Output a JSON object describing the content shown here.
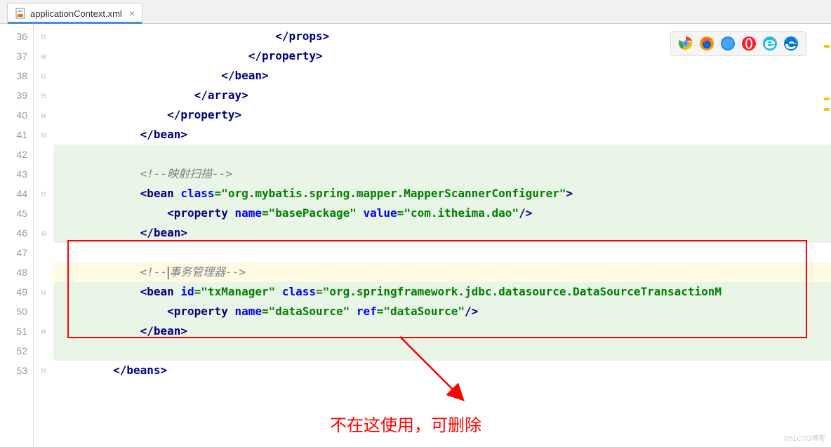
{
  "tab": {
    "filename": "applicationContext.xml",
    "close": "×"
  },
  "lines": {
    "start": 36,
    "end": 53
  },
  "code": {
    "l36": {
      "indent": "                                ",
      "tag": "</props>"
    },
    "l37": {
      "indent": "                            ",
      "tag": "</property>"
    },
    "l38": {
      "indent": "                        ",
      "tag": "</bean>"
    },
    "l39": {
      "indent": "                    ",
      "tag": "</array>"
    },
    "l40": {
      "indent": "                ",
      "tag": "</property>"
    },
    "l41": {
      "indent": "            ",
      "tag": "</bean>"
    },
    "l43": {
      "indent": "            ",
      "comment": "<!--映射扫描-->"
    },
    "l44": {
      "indent": "            ",
      "open": "<bean ",
      "attr1": "class",
      "eq1": "=",
      "val1": "\"org.mybatis.spring.mapper.MapperScannerConfigurer\"",
      "close": ">"
    },
    "l45": {
      "indent": "                ",
      "open": "<property ",
      "attr1": "name",
      "eq1": "=",
      "val1": "\"basePackage\"",
      "sp": " ",
      "attr2": "value",
      "eq2": "=",
      "val2": "\"com.itheima.dao\"",
      "close": "/>"
    },
    "l46": {
      "indent": "            ",
      "tag": "</bean>"
    },
    "l48": {
      "indent": "            ",
      "c1": "<!--",
      "c2": "事务管理器-->"
    },
    "l49": {
      "indent": "            ",
      "open": "<bean ",
      "attr1": "id",
      "eq1": "=",
      "val1": "\"txManager\"",
      "sp": " ",
      "attr2": "class",
      "eq2": "=",
      "val2": "\"org.springframework.jdbc.datasource.DataSourceTransactionM"
    },
    "l50": {
      "indent": "                ",
      "open": "<property ",
      "attr1": "name",
      "eq1": "=",
      "val1": "\"dataSource\"",
      "sp": " ",
      "attr2": "ref",
      "eq2": "=",
      "val2": "\"dataSource\"",
      "close": "/>"
    },
    "l51": {
      "indent": "            ",
      "tag": "</bean>"
    },
    "l53": {
      "indent": "        ",
      "tag": "</beans>"
    }
  },
  "annotation": "不在这使用，可删除",
  "watermark": "©51CTO博客"
}
